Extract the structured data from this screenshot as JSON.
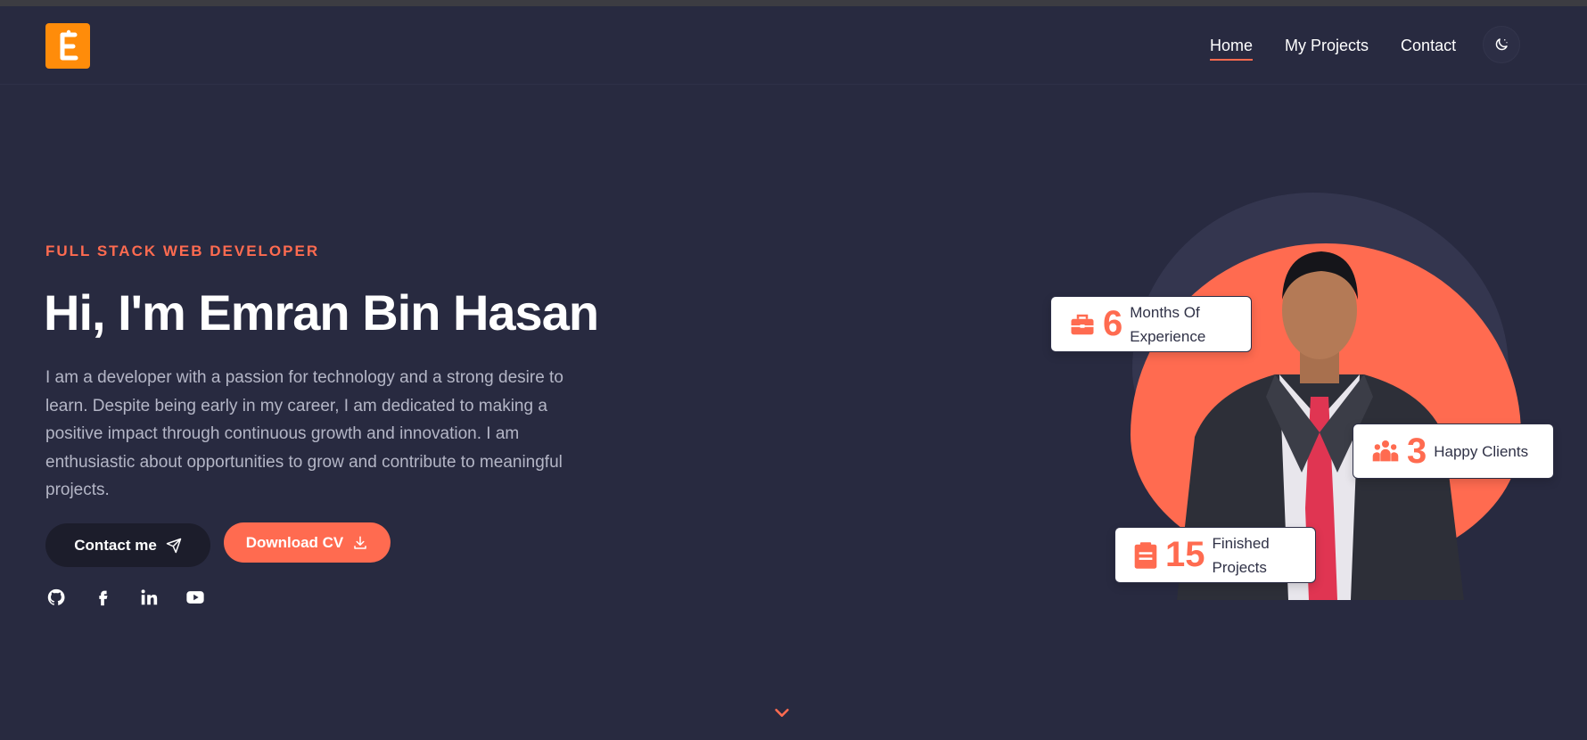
{
  "colors": {
    "background": "#282a40",
    "accent": "#ff6b50",
    "logo": "#ff8c0a"
  },
  "logo": {
    "letter": "E"
  },
  "nav": {
    "items": [
      {
        "label": "Home",
        "active": true
      },
      {
        "label": "My Projects",
        "active": false
      },
      {
        "label": "Contact",
        "active": false
      }
    ],
    "theme_toggle_icon": "moon-icon"
  },
  "hero": {
    "eyebrow": "FULL STACK WEB DEVELOPER",
    "title": "Hi, I'm Emran Bin Hasan",
    "description": "I am a developer with a passion for technology and a strong desire to learn. Despite being early in my career, I am dedicated to making a positive impact through continuous growth and innovation. I am enthusiastic about opportunities to grow and contribute to meaningful projects.",
    "contact_button": "Contact me",
    "cv_button": "Download CV",
    "socials": [
      "github-icon",
      "facebook-icon",
      "linkedin-icon",
      "youtube-icon"
    ]
  },
  "stats": [
    {
      "icon": "briefcase-icon",
      "number": "6",
      "label_line1": "Months Of",
      "label_line2": "Experience"
    },
    {
      "icon": "users-icon",
      "number": "3",
      "label_line1": "Happy Clients",
      "label_line2": ""
    },
    {
      "icon": "clipboard-icon",
      "number": "15",
      "label_line1": "Finished",
      "label_line2": "Projects"
    }
  ],
  "scroll_icon": "chevron-down-icon"
}
